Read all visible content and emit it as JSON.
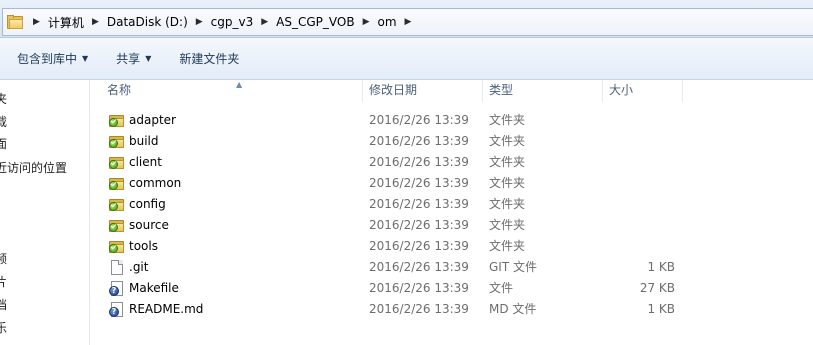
{
  "address": {
    "crumbs": [
      "计算机",
      "DataDisk (D:)",
      "cgp_v3",
      "AS_CGP_VOB",
      "om"
    ]
  },
  "toolbar": {
    "include_library": "包含到库中",
    "share": "共享",
    "new_folder": "新建文件夹"
  },
  "navpane": {
    "items": [
      "夹",
      "载",
      "面",
      "近访问的位置",
      "频",
      "片",
      "档",
      "乐"
    ]
  },
  "columns": {
    "name": "名称",
    "date": "修改日期",
    "type": "类型",
    "size": "大小"
  },
  "files": [
    {
      "name": "adapter",
      "date": "2016/2/26 13:39",
      "type": "文件夹",
      "size": "",
      "icon": "folder-icon"
    },
    {
      "name": "build",
      "date": "2016/2/26 13:39",
      "type": "文件夹",
      "size": "",
      "icon": "folder-icon"
    },
    {
      "name": "client",
      "date": "2016/2/26 13:39",
      "type": "文件夹",
      "size": "",
      "icon": "folder-icon"
    },
    {
      "name": "common",
      "date": "2016/2/26 13:39",
      "type": "文件夹",
      "size": "",
      "icon": "folder-icon"
    },
    {
      "name": "config",
      "date": "2016/2/26 13:39",
      "type": "文件夹",
      "size": "",
      "icon": "folder-icon"
    },
    {
      "name": "source",
      "date": "2016/2/26 13:39",
      "type": "文件夹",
      "size": "",
      "icon": "folder-icon"
    },
    {
      "name": "tools",
      "date": "2016/2/26 13:39",
      "type": "文件夹",
      "size": "",
      "icon": "folder-icon"
    },
    {
      "name": ".git",
      "date": "2016/2/26 13:39",
      "type": "GIT 文件",
      "size": "1 KB",
      "icon": "file-icon"
    },
    {
      "name": "Makefile",
      "date": "2016/2/26 13:39",
      "type": "文件",
      "size": "27 KB",
      "icon": "unknown-file-icon"
    },
    {
      "name": "README.md",
      "date": "2016/2/26 13:39",
      "type": "MD 文件",
      "size": "1 KB",
      "icon": "unknown-file-icon"
    }
  ]
}
